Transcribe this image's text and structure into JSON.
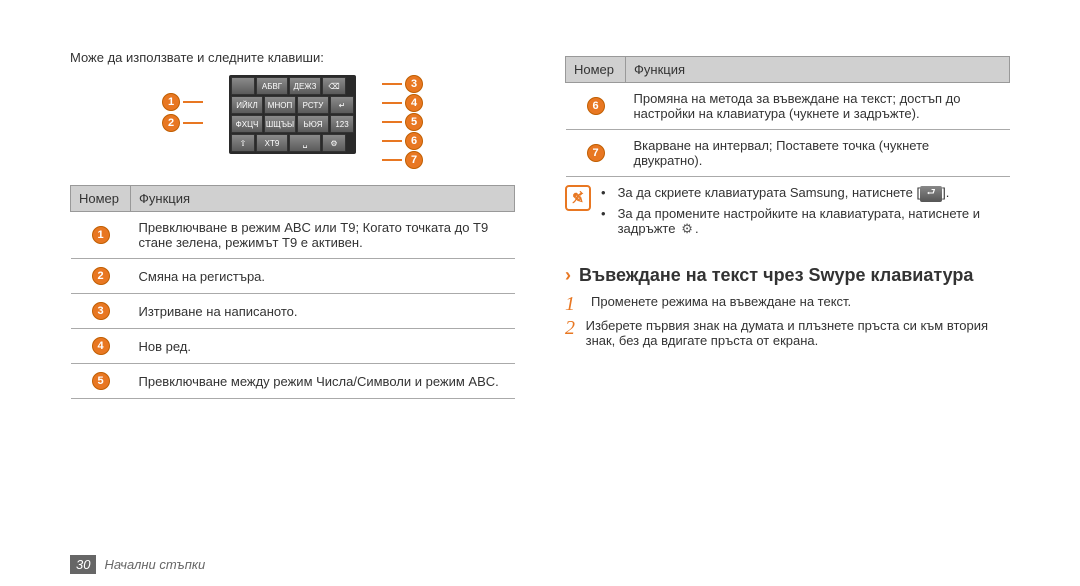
{
  "left": {
    "intro": "Може да използвате и следните клавиши:",
    "keypad_rows": [
      [
        "",
        "АБВГ",
        "ДЕЖЗ",
        ""
      ],
      [
        "ИЙКЛ",
        "МНОП",
        "РСТУ",
        ""
      ],
      [
        "ФХЦЧ",
        "ШЩЪЫ",
        "ЬЮЯ",
        "123"
      ],
      [
        "",
        "XT9",
        "",
        ""
      ]
    ],
    "callouts_left": [
      "1",
      "2"
    ],
    "callouts_right": [
      "3",
      "4",
      "5",
      "6",
      "7"
    ],
    "table": {
      "headers": [
        "Номер",
        "Функция"
      ],
      "rows": [
        {
          "num": "1",
          "text": "Превключване в режим ABC или T9; Когато точката до T9 стане зелена, режимът T9 е активен."
        },
        {
          "num": "2",
          "text": "Смяна на регистъра."
        },
        {
          "num": "3",
          "text": "Изтриване на написаното."
        },
        {
          "num": "4",
          "text": "Нов ред."
        },
        {
          "num": "5",
          "text": "Превключване между режим Числа/Символи и режим ABC."
        }
      ]
    }
  },
  "right": {
    "table": {
      "headers": [
        "Номер",
        "Функция"
      ],
      "rows": [
        {
          "num": "6",
          "text": "Промяна на метода за въвеждане на текст; достъп до настройки на клавиатура (чукнете и задръжте)."
        },
        {
          "num": "7",
          "text": "Вкарване на интервал; Поставете точка (чукнете двукратно)."
        }
      ]
    },
    "note1_pre": "За да скриете клавиатурата Samsung, натиснете [",
    "note1_post": "].",
    "note2_pre": "За да промените настройките на клавиатурата, натиснете и задръжте ",
    "note2_post": ".",
    "section_heading": "Въвеждане на текст чрез Swype клавиатура",
    "steps": [
      {
        "n": "1",
        "t": "Променете режима на въвеждане на текст."
      },
      {
        "n": "2",
        "t": "Изберете първия знак на думата и плъзнете пръста си към втория знак, без да вдигате пръста от екрана."
      }
    ]
  },
  "footer": {
    "page": "30",
    "label": "Начални стъпки"
  }
}
